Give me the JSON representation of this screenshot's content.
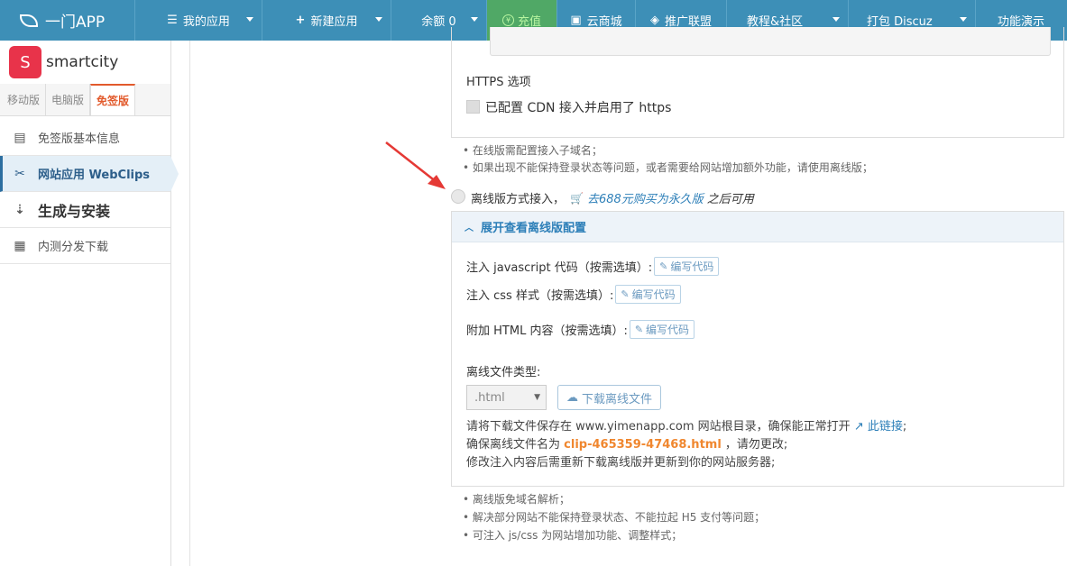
{
  "topnav": {
    "brand": "一门APP",
    "items": [
      {
        "icon": "menu-lines-icon",
        "label": "我的应用"
      },
      {
        "icon": "plus-icon",
        "label": "新建应用"
      },
      {
        "icon": "",
        "label": "余额 0"
      },
      {
        "icon": "yen-coin-icon",
        "label": "充值"
      },
      {
        "icon": "store-icon",
        "label": "云商城"
      },
      {
        "icon": "diamond-icon",
        "label": "推广联盟"
      },
      {
        "icon": "",
        "label": "教程&社区"
      },
      {
        "icon": "",
        "label": "打包 Discuz"
      },
      {
        "icon": "",
        "label": "功能演示"
      }
    ]
  },
  "sidebar": {
    "app_logo_letter": "S",
    "app_name": "smartcity",
    "tabs": [
      "移动版",
      "电脑版",
      "免签版"
    ],
    "items": [
      {
        "icon": "info-card-icon",
        "label": "免签版基本信息"
      },
      {
        "icon": "scissors-icon",
        "label": "网站应用 WebClips"
      },
      {
        "icon": "build-download-icon",
        "label": "生成与安装"
      },
      {
        "icon": "qrcode-icon",
        "label": "内测分发下载"
      }
    ]
  },
  "main": {
    "https_title": "HTTPS 选项",
    "https_checkbox": "已配置 CDN 接入并启用了 https",
    "hint1": "• 在线版需配置接入子域名；",
    "hint2": "• 如果出现不能保持登录状态等问题，或者需要给网站增加额外功能，请使用离线版；",
    "offline_option": "离线版方式接入，",
    "buy_link": "去688元购买为永久版",
    "after_text": "之后可用",
    "offline_panel": {
      "header": "展开查看离线版配置",
      "js_label": "注入 javascript 代码（按需选填）:",
      "css_label": "注入 css 样式（按需选填）:",
      "html_label": "附加 HTML 内容（按需选填）:",
      "edit_code": "编写代码",
      "file_type_label": "离线文件类型:",
      "file_type_value": ".html",
      "download_btn": "下载离线文件",
      "note1_a": "请将下载文件保存在 www.yimenapp.com 网站根目录，确保能正常打开",
      "note1_link": "此链接",
      "note1_end": ";",
      "note2_a": "确保离线文件名为",
      "note2_file": "clip-465359-47468.html",
      "note2_b": "，请勿更改;",
      "note3": "修改注入内容后需重新下载离线版并更新到你的网站服务器;"
    },
    "bottom_hints": [
      "• 离线版免域名解析；",
      "• 解决部分网站不能保持登录状态、不能拉起 H5 支付等问题；",
      "• 可注入 js/css 为网站增加功能、调整样式；"
    ]
  },
  "colors": {
    "nav_bg": "#3d8fb7",
    "pay_bg": "#50a866",
    "active_tab": "#e25a2c",
    "link": "#2d7fb8",
    "filename": "#f0872f",
    "arrow": "#e53935"
  }
}
